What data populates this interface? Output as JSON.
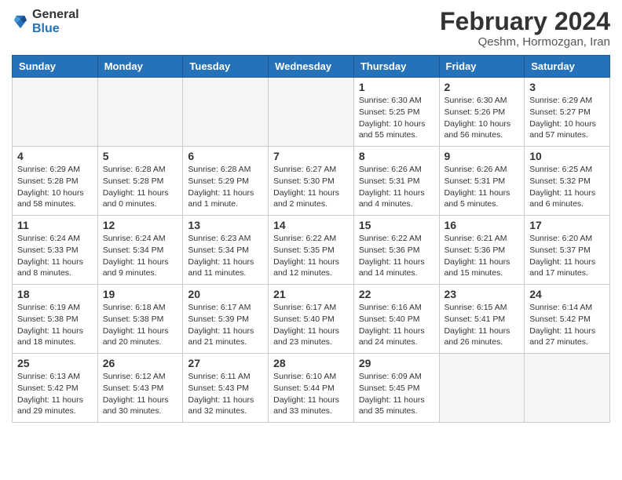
{
  "header": {
    "logo_general": "General",
    "logo_blue": "Blue",
    "month_year": "February 2024",
    "location": "Qeshm, Hormozgan, Iran"
  },
  "days_of_week": [
    "Sunday",
    "Monday",
    "Tuesday",
    "Wednesday",
    "Thursday",
    "Friday",
    "Saturday"
  ],
  "weeks": [
    [
      {
        "day": "",
        "info": "",
        "empty": true
      },
      {
        "day": "",
        "info": "",
        "empty": true
      },
      {
        "day": "",
        "info": "",
        "empty": true
      },
      {
        "day": "",
        "info": "",
        "empty": true
      },
      {
        "day": "1",
        "info": "Sunrise: 6:30 AM\nSunset: 5:25 PM\nDaylight: 10 hours and 55 minutes.",
        "empty": false
      },
      {
        "day": "2",
        "info": "Sunrise: 6:30 AM\nSunset: 5:26 PM\nDaylight: 10 hours and 56 minutes.",
        "empty": false
      },
      {
        "day": "3",
        "info": "Sunrise: 6:29 AM\nSunset: 5:27 PM\nDaylight: 10 hours and 57 minutes.",
        "empty": false
      }
    ],
    [
      {
        "day": "4",
        "info": "Sunrise: 6:29 AM\nSunset: 5:28 PM\nDaylight: 10 hours and 58 minutes.",
        "empty": false
      },
      {
        "day": "5",
        "info": "Sunrise: 6:28 AM\nSunset: 5:28 PM\nDaylight: 11 hours and 0 minutes.",
        "empty": false
      },
      {
        "day": "6",
        "info": "Sunrise: 6:28 AM\nSunset: 5:29 PM\nDaylight: 11 hours and 1 minute.",
        "empty": false
      },
      {
        "day": "7",
        "info": "Sunrise: 6:27 AM\nSunset: 5:30 PM\nDaylight: 11 hours and 2 minutes.",
        "empty": false
      },
      {
        "day": "8",
        "info": "Sunrise: 6:26 AM\nSunset: 5:31 PM\nDaylight: 11 hours and 4 minutes.",
        "empty": false
      },
      {
        "day": "9",
        "info": "Sunrise: 6:26 AM\nSunset: 5:31 PM\nDaylight: 11 hours and 5 minutes.",
        "empty": false
      },
      {
        "day": "10",
        "info": "Sunrise: 6:25 AM\nSunset: 5:32 PM\nDaylight: 11 hours and 6 minutes.",
        "empty": false
      }
    ],
    [
      {
        "day": "11",
        "info": "Sunrise: 6:24 AM\nSunset: 5:33 PM\nDaylight: 11 hours and 8 minutes.",
        "empty": false
      },
      {
        "day": "12",
        "info": "Sunrise: 6:24 AM\nSunset: 5:34 PM\nDaylight: 11 hours and 9 minutes.",
        "empty": false
      },
      {
        "day": "13",
        "info": "Sunrise: 6:23 AM\nSunset: 5:34 PM\nDaylight: 11 hours and 11 minutes.",
        "empty": false
      },
      {
        "day": "14",
        "info": "Sunrise: 6:22 AM\nSunset: 5:35 PM\nDaylight: 11 hours and 12 minutes.",
        "empty": false
      },
      {
        "day": "15",
        "info": "Sunrise: 6:22 AM\nSunset: 5:36 PM\nDaylight: 11 hours and 14 minutes.",
        "empty": false
      },
      {
        "day": "16",
        "info": "Sunrise: 6:21 AM\nSunset: 5:36 PM\nDaylight: 11 hours and 15 minutes.",
        "empty": false
      },
      {
        "day": "17",
        "info": "Sunrise: 6:20 AM\nSunset: 5:37 PM\nDaylight: 11 hours and 17 minutes.",
        "empty": false
      }
    ],
    [
      {
        "day": "18",
        "info": "Sunrise: 6:19 AM\nSunset: 5:38 PM\nDaylight: 11 hours and 18 minutes.",
        "empty": false
      },
      {
        "day": "19",
        "info": "Sunrise: 6:18 AM\nSunset: 5:38 PM\nDaylight: 11 hours and 20 minutes.",
        "empty": false
      },
      {
        "day": "20",
        "info": "Sunrise: 6:17 AM\nSunset: 5:39 PM\nDaylight: 11 hours and 21 minutes.",
        "empty": false
      },
      {
        "day": "21",
        "info": "Sunrise: 6:17 AM\nSunset: 5:40 PM\nDaylight: 11 hours and 23 minutes.",
        "empty": false
      },
      {
        "day": "22",
        "info": "Sunrise: 6:16 AM\nSunset: 5:40 PM\nDaylight: 11 hours and 24 minutes.",
        "empty": false
      },
      {
        "day": "23",
        "info": "Sunrise: 6:15 AM\nSunset: 5:41 PM\nDaylight: 11 hours and 26 minutes.",
        "empty": false
      },
      {
        "day": "24",
        "info": "Sunrise: 6:14 AM\nSunset: 5:42 PM\nDaylight: 11 hours and 27 minutes.",
        "empty": false
      }
    ],
    [
      {
        "day": "25",
        "info": "Sunrise: 6:13 AM\nSunset: 5:42 PM\nDaylight: 11 hours and 29 minutes.",
        "empty": false
      },
      {
        "day": "26",
        "info": "Sunrise: 6:12 AM\nSunset: 5:43 PM\nDaylight: 11 hours and 30 minutes.",
        "empty": false
      },
      {
        "day": "27",
        "info": "Sunrise: 6:11 AM\nSunset: 5:43 PM\nDaylight: 11 hours and 32 minutes.",
        "empty": false
      },
      {
        "day": "28",
        "info": "Sunrise: 6:10 AM\nSunset: 5:44 PM\nDaylight: 11 hours and 33 minutes.",
        "empty": false
      },
      {
        "day": "29",
        "info": "Sunrise: 6:09 AM\nSunset: 5:45 PM\nDaylight: 11 hours and 35 minutes.",
        "empty": false
      },
      {
        "day": "",
        "info": "",
        "empty": true
      },
      {
        "day": "",
        "info": "",
        "empty": true
      }
    ]
  ]
}
